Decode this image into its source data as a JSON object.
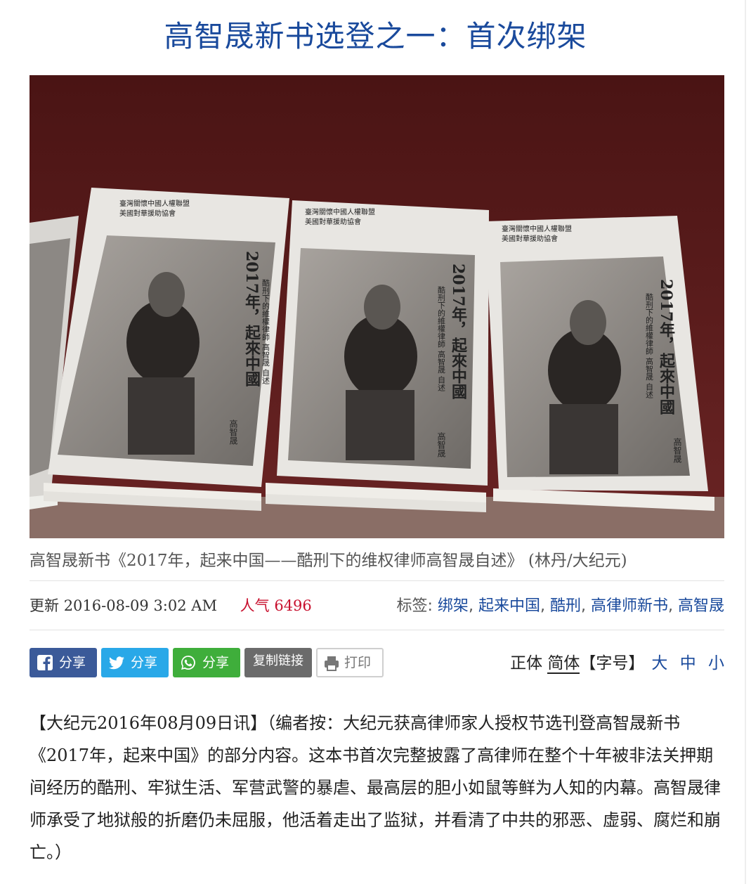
{
  "article": {
    "title": "高智晟新书选登之一：首次绑架",
    "caption": "高智晟新书《2017年，起来中国——酷刑下的维权律师高智晟自述》 (林丹/大纪元)",
    "updated_label": "更新",
    "updated_value": "2016-08-09 3:02 AM",
    "views_label": "人气",
    "views_value": "6496",
    "tags_label": "标签:",
    "tags": [
      "绑架",
      "起来中国",
      "酷刑",
      "高律师新书",
      "高智晟"
    ],
    "body": "【大纪元2016年08月09日讯】（编者按：大纪元获高律师家人授权节选刊登高智晟新书《2017年，起来中国》的部分内容。这本书首次完整披露了高律师在整个十年被非法关押期间经历的酷刑、牢狱生活、军营武警的暴虐、最高层的胆小如鼠等鲜为人知的内幕。高智晟律师承受了地狱般的折磨仍未屈服，他活着走出了监狱，并看清了中共的邪恶、虚弱、腐烂和崩亡。）"
  },
  "share": {
    "facebook_label": "分享",
    "twitter_label": "分享",
    "whatsapp_label": "分享",
    "copy_label": "复制链接",
    "print_label": "打印"
  },
  "font_controls": {
    "traditional": "正体",
    "simplified": "简体",
    "size_label": "【字号】",
    "large": "大",
    "medium": "中",
    "small": "小"
  },
  "photo": {
    "book_cover_publisher_1": "臺灣關懷中國人權聯盟",
    "book_cover_publisher_2": "美國對華援助協會",
    "book_cover_title": "2017年，起來中國",
    "book_cover_subtitle": "酷刑下的維權律師 高智晟 自述",
    "book_cover_author": "高智晟"
  },
  "colors": {
    "title_blue": "#1a4a9c",
    "views_red": "#c8102e",
    "facebook": "#3b5a99",
    "twitter": "#29a8e8",
    "whatsapp": "#3fae3b",
    "copy": "#6b6b6b"
  }
}
